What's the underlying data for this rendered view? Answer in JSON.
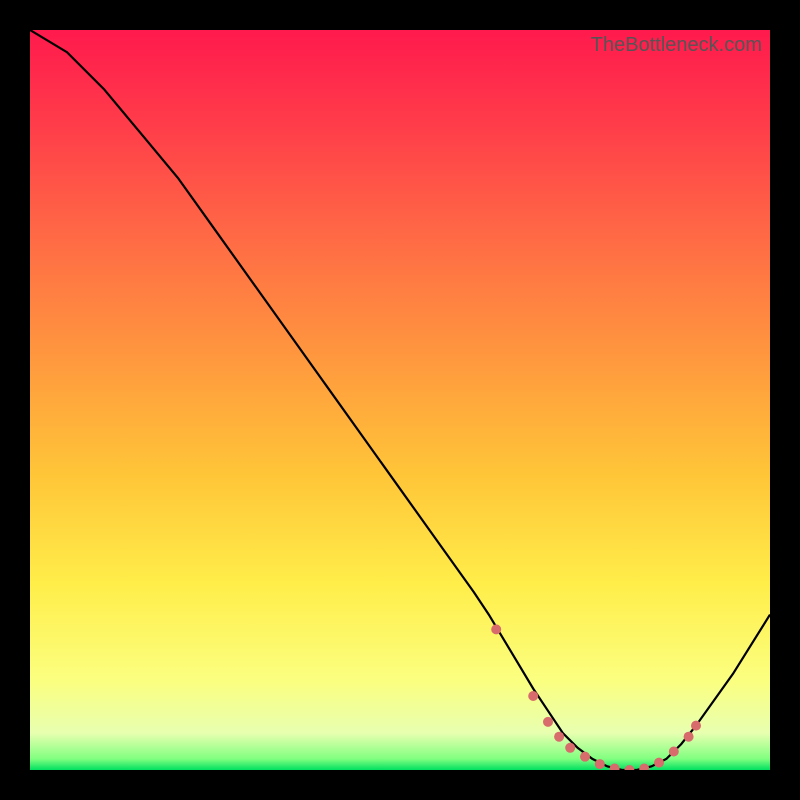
{
  "watermark": "TheBottleneck.com",
  "chart_data": {
    "type": "line",
    "title": "",
    "xlabel": "",
    "ylabel": "",
    "xlim": [
      0,
      100
    ],
    "ylim": [
      0,
      100
    ],
    "series": [
      {
        "name": "bottleneck-curve",
        "x": [
          0,
          5,
          10,
          15,
          20,
          25,
          30,
          35,
          40,
          45,
          50,
          55,
          60,
          62,
          65,
          68,
          70,
          72,
          74,
          76,
          78,
          80,
          82,
          84,
          86,
          88,
          90,
          95,
          100
        ],
        "y": [
          100,
          97,
          92,
          86,
          80,
          73,
          66,
          59,
          52,
          45,
          38,
          31,
          24,
          21,
          16,
          11,
          8,
          5,
          3,
          1.5,
          0.5,
          0,
          0,
          0.5,
          1.5,
          3.5,
          6,
          13,
          21
        ]
      }
    ],
    "markers": {
      "name": "highlight-points",
      "color": "#d86b6b",
      "x": [
        63,
        68,
        70,
        71.5,
        73,
        75,
        77,
        79,
        81,
        83,
        85,
        87,
        89,
        90
      ],
      "y": [
        19,
        10,
        6.5,
        4.5,
        3,
        1.8,
        0.8,
        0.2,
        0,
        0.2,
        1,
        2.5,
        4.5,
        6
      ]
    },
    "gradient": {
      "stops": [
        {
          "offset": 0,
          "color": "#ff1a4d"
        },
        {
          "offset": 0.12,
          "color": "#ff3a4a"
        },
        {
          "offset": 0.28,
          "color": "#ff6a45"
        },
        {
          "offset": 0.45,
          "color": "#ff9a3e"
        },
        {
          "offset": 0.6,
          "color": "#ffc538"
        },
        {
          "offset": 0.75,
          "color": "#ffee4a"
        },
        {
          "offset": 0.88,
          "color": "#fbff80"
        },
        {
          "offset": 0.95,
          "color": "#e8ffb0"
        },
        {
          "offset": 0.985,
          "color": "#80ff80"
        },
        {
          "offset": 1.0,
          "color": "#00e060"
        }
      ]
    }
  }
}
